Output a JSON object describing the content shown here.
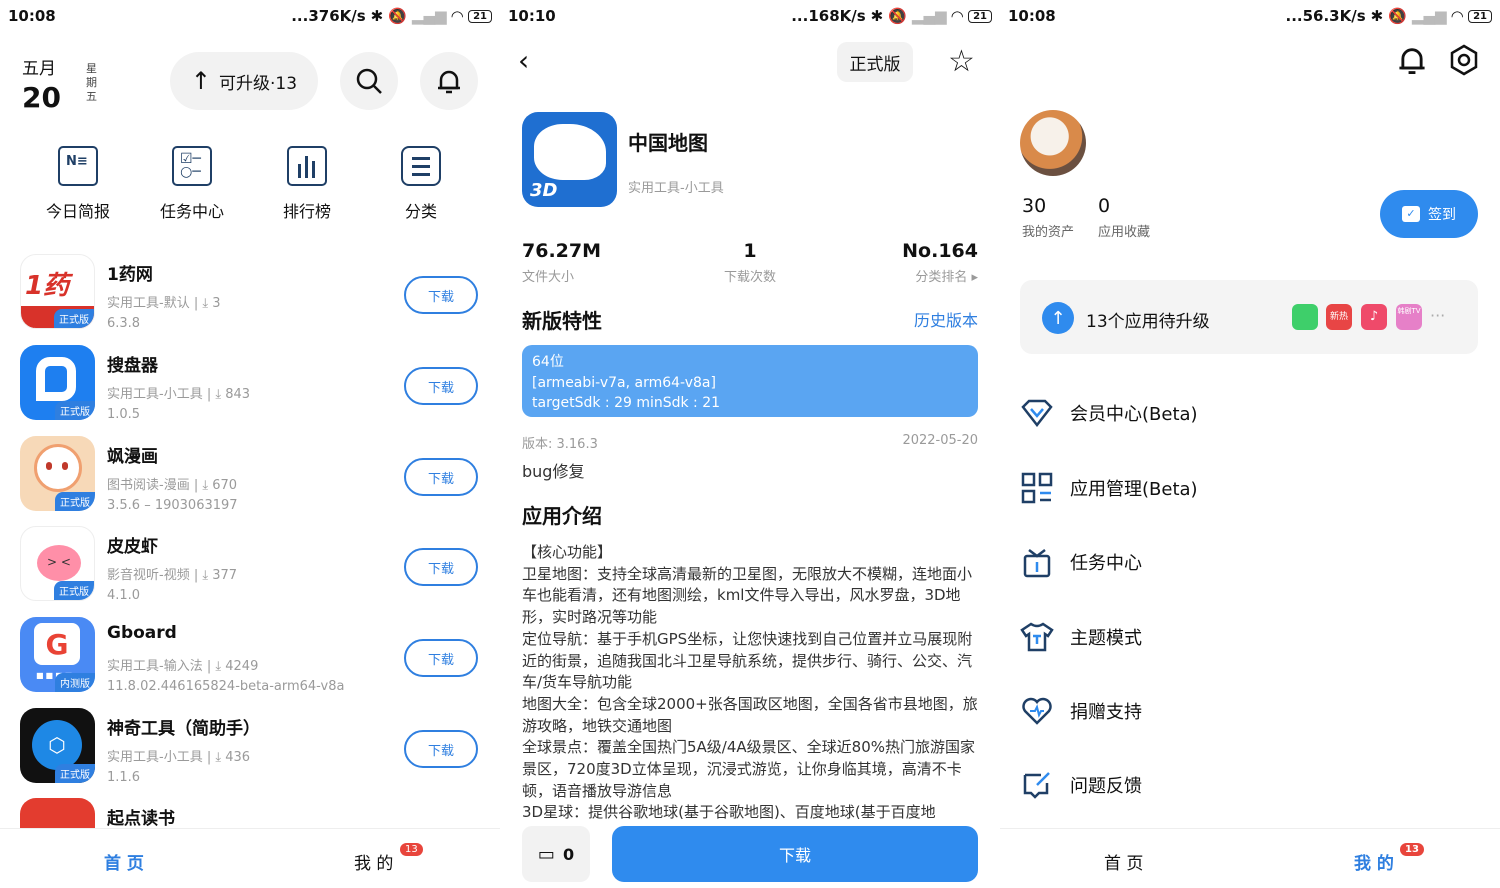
{
  "panel1": {
    "status": {
      "time": "10:08",
      "speed": "...376K/s",
      "battery": "21"
    },
    "date": {
      "month": "五月",
      "day": "20",
      "weekday": "星期五"
    },
    "upgrade_button": "可升级·13",
    "quick": [
      {
        "label": "今日简报",
        "icon": "news-icon"
      },
      {
        "label": "任务中心",
        "icon": "tasks-icon"
      },
      {
        "label": "排行榜",
        "icon": "chart-icon"
      },
      {
        "label": "分类",
        "icon": "category-icon"
      }
    ],
    "apps": [
      {
        "name": "1药网",
        "meta": "实用工具-默认 |",
        "downloads": "3",
        "version": "6.3.8",
        "tag": "正式版",
        "icon_color": "#e7473a"
      },
      {
        "name": "搜盘器",
        "meta": "实用工具-小工具 |",
        "downloads": "843",
        "version": "1.0.5",
        "tag": "正式版",
        "icon_color": "#1e7ff0"
      },
      {
        "name": "飒漫画",
        "meta": "图书阅读-漫画 |",
        "downloads": "670",
        "version": "3.5.6 – 1903063197",
        "tag": "正式版",
        "icon_color": "#f7d9b8"
      },
      {
        "name": "皮皮虾",
        "meta": "影音视听-视频 |",
        "downloads": "377",
        "version": "4.1.0",
        "tag": "正式版",
        "icon_color": "#ff8fa8"
      },
      {
        "name": "Gboard",
        "meta": "实用工具-输入法 |",
        "downloads": "4249",
        "version": "11.8.02.446165824-beta-arm64-v8a",
        "tag": "内测版",
        "icon_color": "#4a8af4"
      },
      {
        "name": "神奇工具（简助手）",
        "meta": "实用工具-小工具 |",
        "downloads": "436",
        "version": "1.1.6",
        "tag": "正式版",
        "icon_color": "#1a1a1a"
      },
      {
        "name": "起点读书",
        "meta": "",
        "downloads": "",
        "version": "",
        "tag": "",
        "icon_color": "#e33c2f"
      }
    ],
    "download_label": "下载",
    "nav": {
      "home": "首 页",
      "mine": "我 的",
      "badge": "13"
    }
  },
  "panel2": {
    "status": {
      "time": "10:10",
      "speed": "...168K/s",
      "battery": "21"
    },
    "version_chip": "正式版",
    "app": {
      "name": "中国地图",
      "category": "实用工具-小工具",
      "icon_text": "3D"
    },
    "stats": [
      {
        "value": "76.27M",
        "label": "文件大小"
      },
      {
        "value": "1",
        "label": "下载次数"
      },
      {
        "value": "No.164",
        "label": "分类排名"
      }
    ],
    "features_title": "新版特性",
    "history_link": "历史版本",
    "build_info": [
      "64位",
      "[armeabi-v7a, arm64-v8a]",
      "targetSdk : 29   minSdk : 21"
    ],
    "version": "版本: 3.16.3",
    "date": "2022-05-20",
    "changelog": "bug修复",
    "intro_title": "应用介绍",
    "intro": [
      "【核心功能】",
      "卫星地图：支持全球高清最新的卫星图，无限放大不模糊，连地面小车也能看清，还有地图测绘，kml文件导入导出，风水罗盘，3D地形，实时路况等功能",
      "定位导航：基于手机GPS坐标，让您快速找到自己位置并立马展现附近的街景，追随我国北斗卫星导航系统，提供步行、骑行、公交、汽车/货车导航功能",
      "地图大全：包含全球2000+张各国政区地图，全国各省市县地图，旅游攻略，地铁交通地图",
      "全球景点：覆盖全国热门5A级/4A级景区、全球近80%热门旅游国家景区，720度3D立体呈现，沉浸式游览，让你身临其境，高清不卡顿，语音播放导游信息",
      "3D星球：提供谷歌地球(基于谷歌地图)、百度地球(基于百度地"
    ],
    "comment_count": "0",
    "download_button": "下载"
  },
  "panel3": {
    "status": {
      "time": "10:08",
      "speed": "...56.3K/s",
      "battery": "21"
    },
    "stats": [
      {
        "value": "30",
        "label": "我的资产"
      },
      {
        "value": "0",
        "label": "应用收藏"
      }
    ],
    "signin": "签到",
    "upgrade_card": {
      "text": "13个应用待升级",
      "mini_apps": [
        {
          "name": "",
          "color": "#3ecf6a"
        },
        {
          "name": "新热",
          "color": "#e84545"
        },
        {
          "name": "",
          "color": "#ef4a6a"
        },
        {
          "name": "韩剧TV",
          "color": "#e680c8"
        }
      ]
    },
    "menu": [
      {
        "label": "会员中心(Beta)",
        "icon": "vip-diamond-icon"
      },
      {
        "label": "应用管理(Beta)",
        "icon": "app-manage-icon"
      },
      {
        "label": "任务中心",
        "icon": "gift-box-icon"
      },
      {
        "label": "主题模式",
        "icon": "tshirt-icon"
      },
      {
        "label": "捐赠支持",
        "icon": "heart-icon"
      },
      {
        "label": "问题反馈",
        "icon": "feedback-icon"
      }
    ],
    "nav": {
      "home": "首 页",
      "mine": "我 的",
      "badge": "13"
    }
  }
}
